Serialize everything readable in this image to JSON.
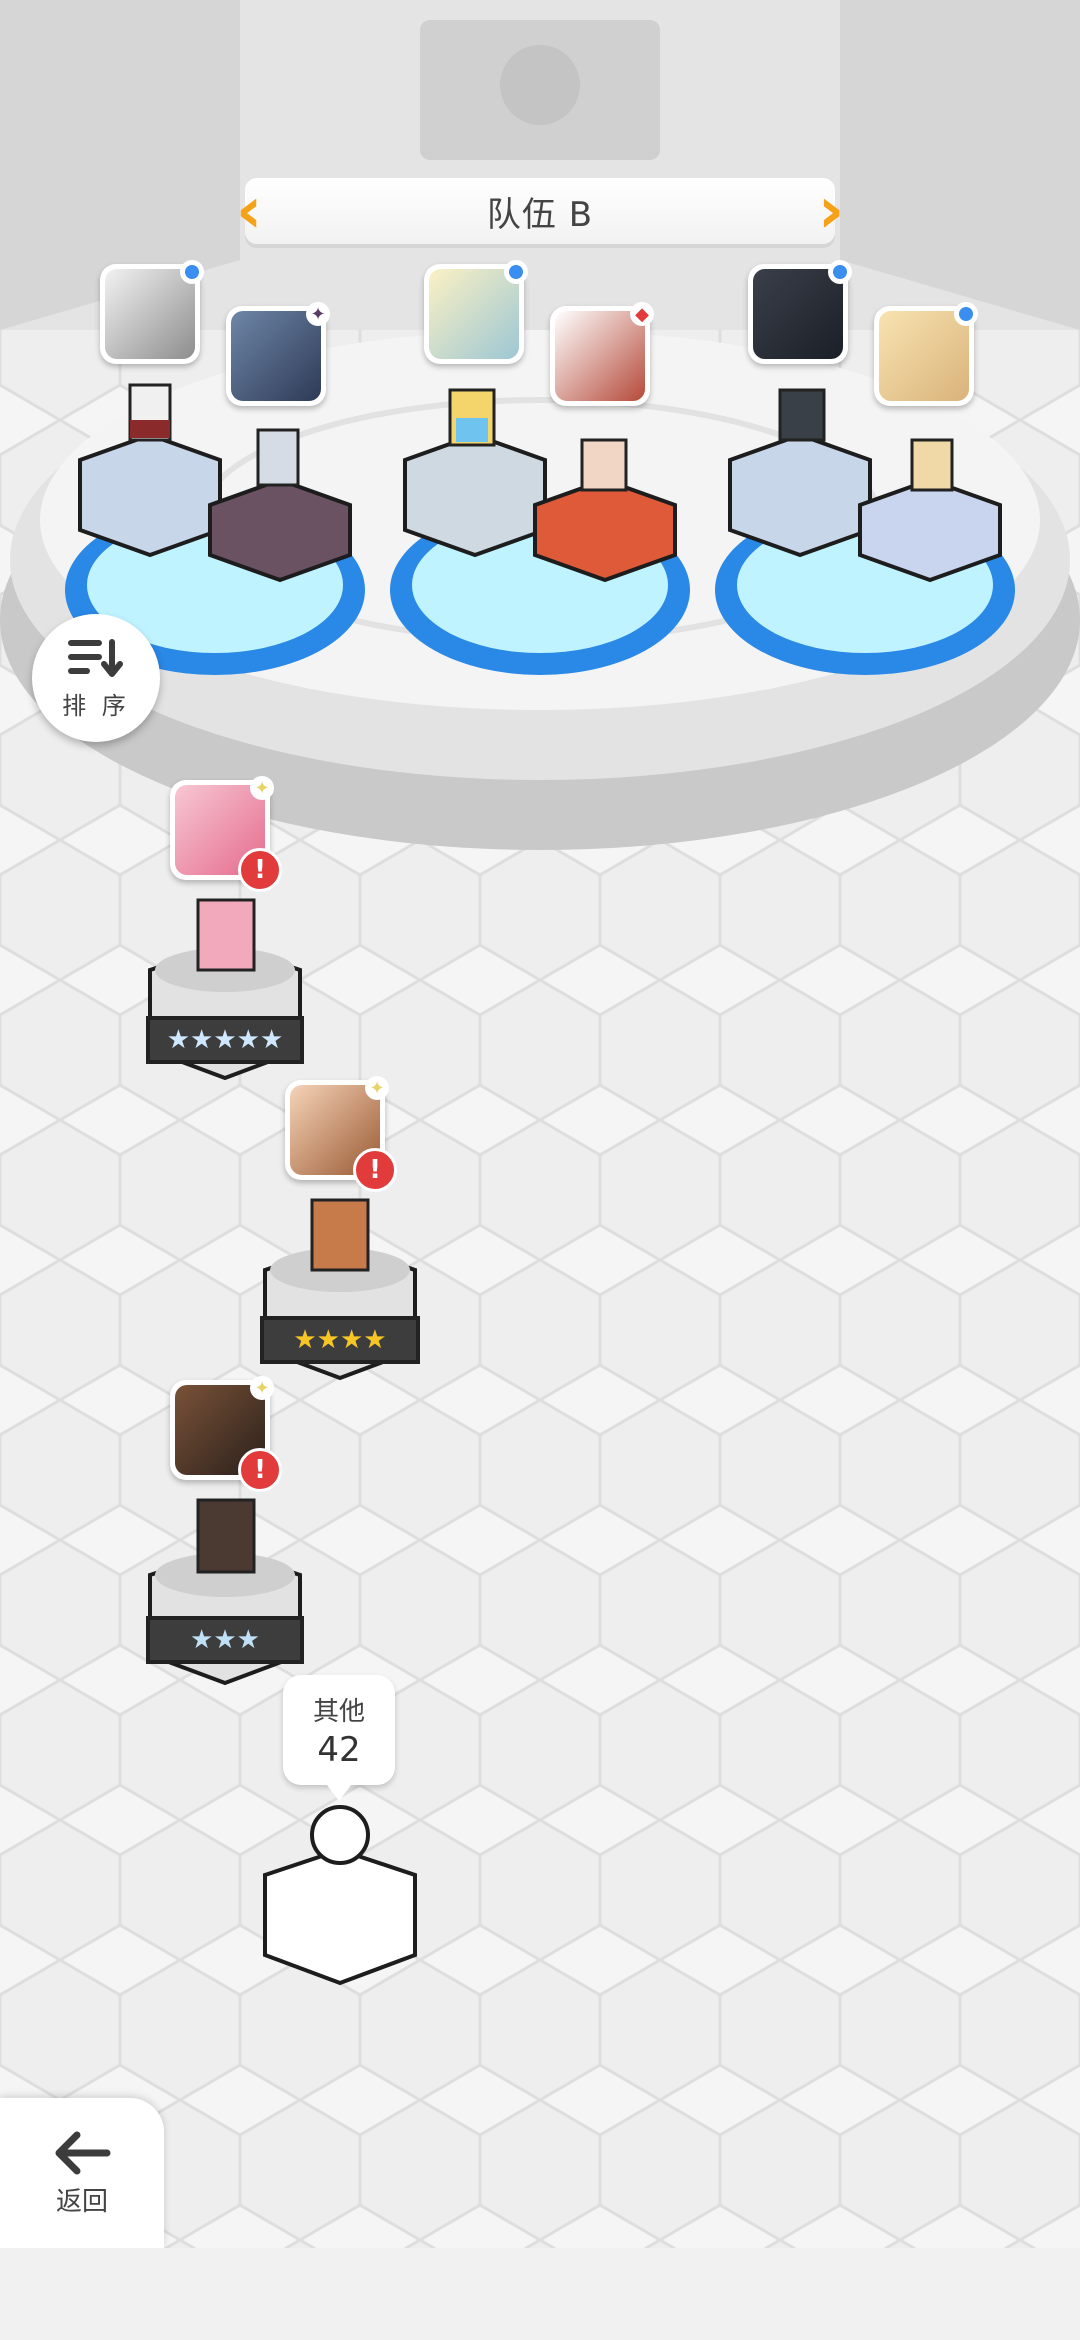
{
  "team": {
    "title": "队伍 B"
  },
  "sort_button": {
    "label": "排 序"
  },
  "roster": [
    {
      "stars": "★★★★★",
      "star_color": "#cfe8ff"
    },
    {
      "stars": "★★★★",
      "star_color": "#f7c525"
    },
    {
      "stars": "★★★",
      "star_color": "#bfe0f5"
    }
  ],
  "others": {
    "label": "其他",
    "count": "42"
  },
  "back_button": {
    "label": "返回"
  },
  "icons": {
    "sort": "sort-icon",
    "back": "arrow-left-icon",
    "alert": "!"
  },
  "colors": {
    "accent": "#f5a218",
    "alert": "#e23b3b",
    "badge": "#3a8ef0",
    "platform_blue": "#3a86e0"
  }
}
